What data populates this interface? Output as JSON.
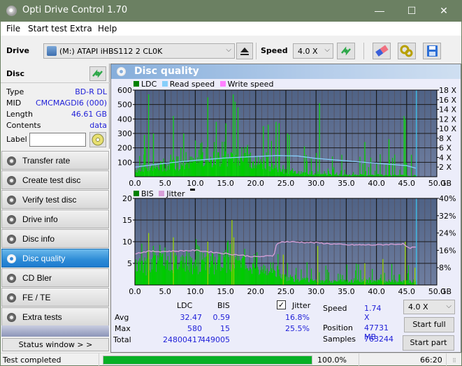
{
  "window": {
    "title": "Opti Drive Control 1.70",
    "controls": {
      "minimize": "—",
      "maximize": "☐",
      "close": "✕"
    }
  },
  "menu": [
    "File",
    "Start test",
    "Extra",
    "Help"
  ],
  "toolbar": {
    "drive_label": "Drive",
    "drive_value": "(M:)  ATAPI iHBS112  2 CL0K",
    "speed_label": "Speed",
    "speed_value": "4.0 X",
    "icons": [
      "eject-icon",
      "refresh-icon",
      "eraser-icon",
      "settings-icon",
      "save-icon"
    ]
  },
  "disc": {
    "header": "Disc",
    "fields": [
      {
        "key": "Type",
        "value": "BD-R DL"
      },
      {
        "key": "MID",
        "value": "CMCMAGDI6 (000)"
      },
      {
        "key": "Length",
        "value": "46.61 GB"
      },
      {
        "key": "Contents",
        "value": "data"
      }
    ],
    "label_key": "Label",
    "label_value": ""
  },
  "nav": [
    {
      "label": "Transfer rate",
      "active": false
    },
    {
      "label": "Create test disc",
      "active": false
    },
    {
      "label": "Verify test disc",
      "active": false
    },
    {
      "label": "Drive info",
      "active": false
    },
    {
      "label": "Disc info",
      "active": false
    },
    {
      "label": "Disc quality",
      "active": true
    },
    {
      "label": "CD Bler",
      "active": false
    },
    {
      "label": "FE / TE",
      "active": false
    },
    {
      "label": "Extra tests",
      "active": false
    }
  ],
  "status_window_label": "Status window > >",
  "panel_title": "Disc quality",
  "colors": {
    "ldc": "#008000",
    "read_speed": "#87cefa",
    "write_speed": "#ff80ff",
    "bis": "#008000",
    "jitter": "#d8a0d8",
    "bars": "#00cc00",
    "plot_bg_top": "#4f6285",
    "plot_bg_bottom": "#6f7ea0",
    "progress": "#06b025"
  },
  "chart_data": [
    {
      "type": "bar",
      "title": "LDC / Read speed",
      "legend": [
        "LDC",
        "Read speed",
        "Write speed"
      ],
      "xlabel": "GB",
      "x_ticks": [
        "0.0",
        "5.0",
        "10.0",
        "15.0",
        "20.0",
        "25.0",
        "30.0",
        "35.0",
        "40.0",
        "45.0",
        "50.0"
      ],
      "xlim": [
        0,
        50
      ],
      "y_left_ticks": [
        "100",
        "200",
        "300",
        "400",
        "500",
        "600"
      ],
      "ylim_left": [
        0,
        600
      ],
      "y_right_ticks": [
        "2 X",
        "4 X",
        "6 X",
        "8 X",
        "10 X",
        "12 X",
        "14 X",
        "16 X",
        "18 X"
      ],
      "ylim_right": [
        0,
        18
      ],
      "end_marker_gb": 46.61,
      "series": [
        {
          "name": "LDC baseline",
          "x": [
            0,
            5,
            10,
            15,
            20,
            23,
            25,
            30,
            35,
            40,
            45,
            46.6
          ],
          "values": [
            60,
            90,
            120,
            140,
            120,
            80,
            40,
            20,
            15,
            15,
            10,
            10
          ]
        },
        {
          "name": "LDC spikes",
          "x": [
            1.5,
            2.2,
            3.0,
            6.3,
            8.0,
            12.0,
            13.4,
            15.0,
            16.2,
            16.5,
            17.0,
            21.2,
            22.0,
            23.3,
            23.8,
            25.2,
            25.5,
            28.0,
            30.5,
            38.0,
            42.0,
            44.5,
            44.7
          ],
          "values": [
            290,
            570,
            300,
            420,
            300,
            550,
            380,
            370,
            570,
            520,
            480,
            350,
            360,
            380,
            370,
            300,
            290,
            210,
            510,
            240,
            260,
            420,
            400
          ]
        },
        {
          "name": "Read speed",
          "x": [
            0,
            5,
            10,
            15,
            20,
            23.5,
            27,
            30,
            35,
            40,
            45,
            46.6
          ],
          "values": [
            2.0,
            2.8,
            3.4,
            3.9,
            4.2,
            4.4,
            4.3,
            3.8,
            3.3,
            2.8,
            2.3,
            1.74
          ]
        }
      ]
    },
    {
      "type": "bar",
      "title": "BIS / Jitter",
      "legend": [
        "BIS",
        "Jitter"
      ],
      "xlabel": "GB",
      "x_ticks": [
        "0.0",
        "5.0",
        "10.0",
        "15.0",
        "20.0",
        "25.0",
        "30.0",
        "35.0",
        "40.0",
        "45.0",
        "50.0"
      ],
      "xlim": [
        0,
        50
      ],
      "y_left_ticks": [
        "5",
        "10",
        "15",
        "20"
      ],
      "ylim_left": [
        0,
        20
      ],
      "y_right_ticks": [
        "8%",
        "16%",
        "24%",
        "32%",
        "40%"
      ],
      "ylim_right": [
        0,
        40
      ],
      "end_marker_gb": 46.61,
      "series": [
        {
          "name": "BIS baseline",
          "x": [
            0,
            5,
            10,
            15,
            20,
            23,
            25,
            30,
            35,
            40,
            45,
            46.6
          ],
          "values": [
            5,
            6,
            6,
            6,
            5,
            4,
            2,
            1,
            1,
            1,
            1,
            1
          ]
        },
        {
          "name": "BIS spikes",
          "x": [
            2.2,
            6.3,
            12.0,
            16.0,
            16.3,
            24.5,
            30.2,
            38.0,
            41.0,
            44.7,
            46.3
          ],
          "values": [
            12,
            11,
            10,
            15,
            11,
            7,
            9,
            5,
            6,
            10,
            4
          ]
        },
        {
          "name": "Jitter",
          "x": [
            0,
            2,
            5,
            10,
            15,
            20,
            23,
            23.5,
            25,
            30,
            35,
            40,
            44.5,
            45.2,
            46.6
          ],
          "values": [
            14.5,
            15.5,
            15.5,
            16,
            14.5,
            13,
            13.5,
            19.5,
            20,
            19.5,
            18.5,
            18.5,
            19,
            17,
            17.5
          ]
        }
      ]
    }
  ],
  "stats": {
    "col_ldc": "LDC",
    "col_bis": "BIS",
    "jitter_checked": true,
    "jitter_label": "Jitter",
    "rows": [
      {
        "label": "Avg",
        "ldc": "32.47",
        "bis": "0.59",
        "jitter": "16.8%"
      },
      {
        "label": "Max",
        "ldc": "580",
        "bis": "15",
        "jitter": "25.5%"
      },
      {
        "label": "Total",
        "ldc": "24800417",
        "bis": "449005",
        "jitter": ""
      }
    ],
    "speed_label": "Speed",
    "speed_value": "1.74 X",
    "position_label": "Position",
    "position_value": "47731 MB",
    "samples_label": "Samples",
    "samples_value": "763244",
    "speed_select": "4.0 X",
    "start_full": "Start full",
    "start_part": "Start part"
  },
  "statusbar": {
    "text": "Test completed",
    "progress_percent": 100,
    "progress_label": "100.0%",
    "time": "66:20"
  }
}
